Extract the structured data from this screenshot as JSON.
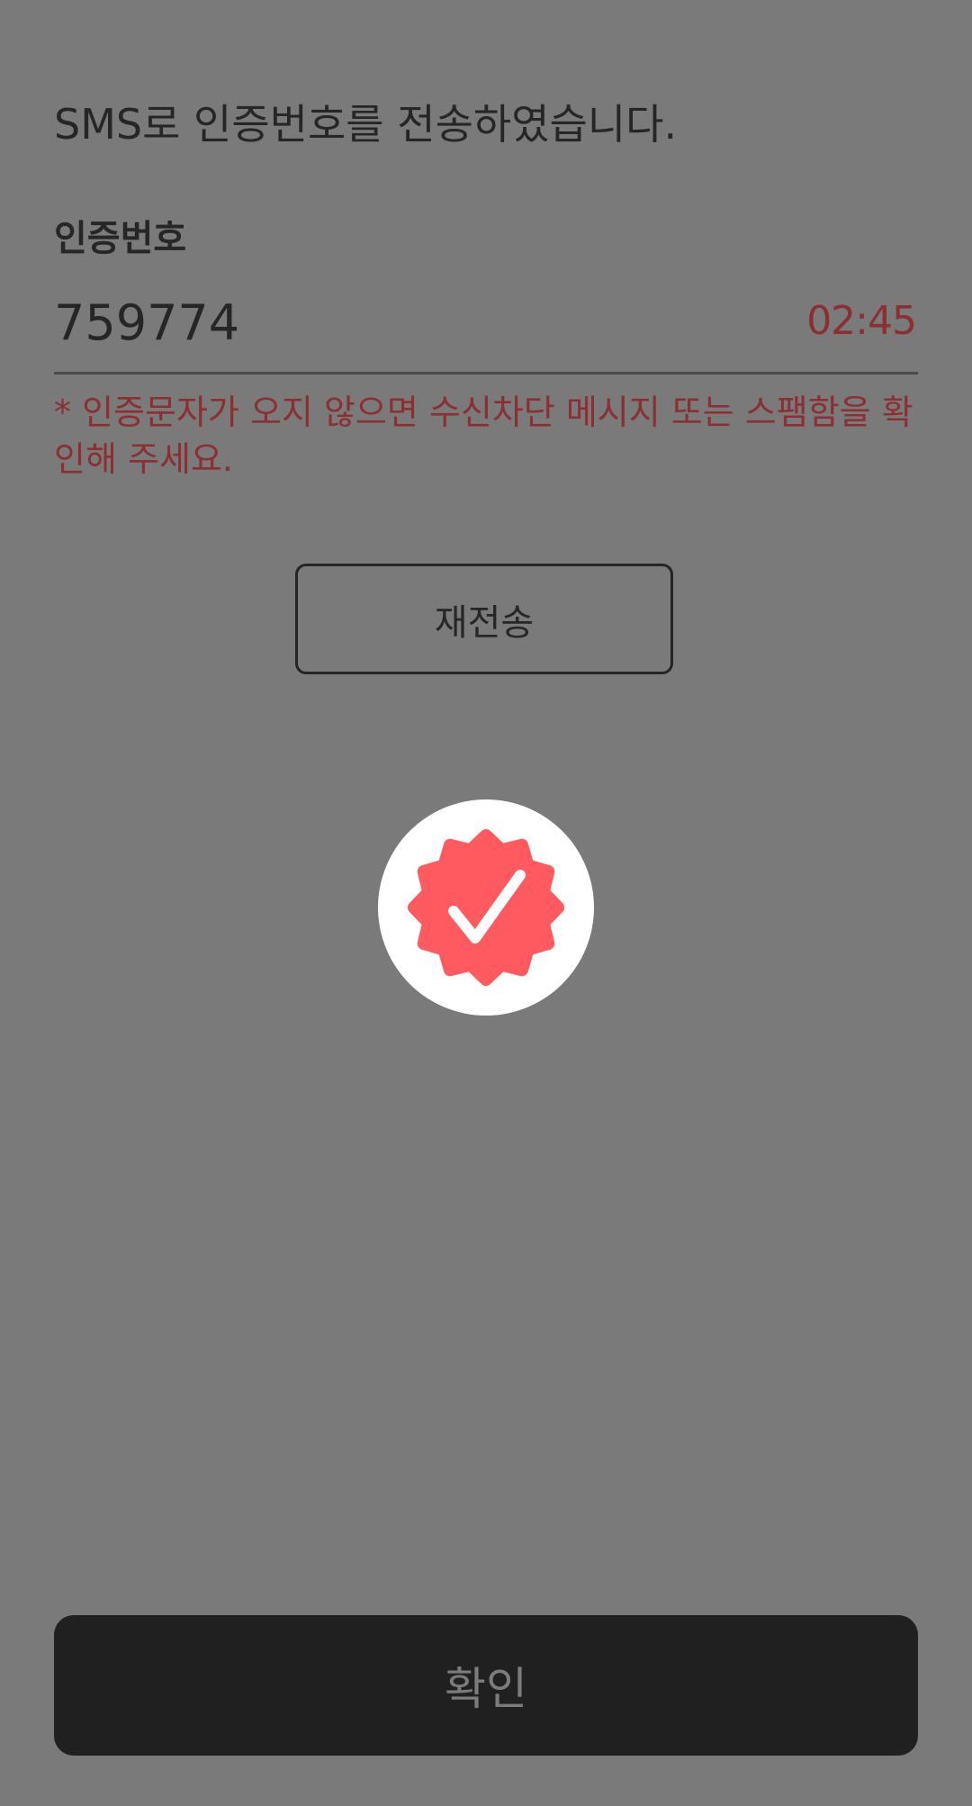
{
  "header": {
    "message": "SMS로 인증번호를 전송하였습니다."
  },
  "verification": {
    "label": "인증번호",
    "code_value": "759774",
    "timer": "02:45",
    "notice": "* 인증문자가 오지 않으면 수신차단 메시지 또는 스팸함을 확인해 주세요."
  },
  "actions": {
    "resend_label": "재전송",
    "confirm_label": "확인"
  },
  "badge": {
    "icon": "verified-check-icon",
    "color": "#ff5a5f"
  },
  "colors": {
    "background": "#7a7a7a",
    "accent": "#8b2f33",
    "button_dark": "#202020"
  }
}
